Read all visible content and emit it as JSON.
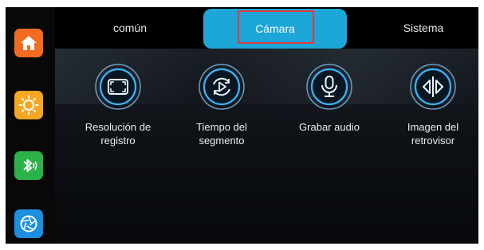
{
  "sidebar": {
    "items": [
      {
        "icon": "home-icon",
        "color": "#f26b21"
      },
      {
        "icon": "brightness-icon",
        "color": "#f5a623"
      },
      {
        "icon": "bluetooth-icon",
        "color": "#2bb34a"
      },
      {
        "icon": "camera-aperture-icon",
        "color": "#1c8fe0"
      }
    ]
  },
  "tabs": [
    {
      "label": "común",
      "active": false
    },
    {
      "label": "Cámara",
      "active": true
    },
    {
      "label": "Sistema",
      "active": false
    }
  ],
  "accent_color": "#1da6d8",
  "features": [
    {
      "icon": "resolution-icon",
      "label_line1": "Resolución de",
      "label_line2": "registro"
    },
    {
      "icon": "segment-time-icon",
      "label_line1": "Tiempo del",
      "label_line2": "segmento"
    },
    {
      "icon": "microphone-icon",
      "label_line1": "Grabar audio",
      "label_line2": ""
    },
    {
      "icon": "mirror-image-icon",
      "label_line1": "Imagen del",
      "label_line2": "retrovisor"
    }
  ]
}
